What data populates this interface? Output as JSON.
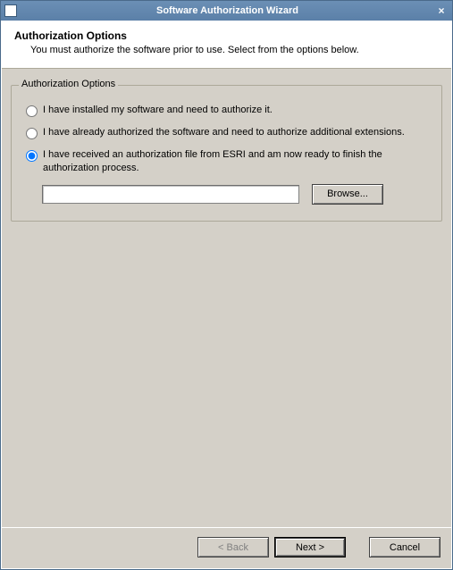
{
  "window": {
    "title": "Software Authorization Wizard"
  },
  "header": {
    "title": "Authorization Options",
    "subtitle": "You must authorize the software prior to use. Select from the options below."
  },
  "group": {
    "legend": "Authorization Options",
    "options": [
      {
        "label": "I have installed my software and need to authorize it.",
        "selected": false
      },
      {
        "label": "I have already authorized the software and need to authorize additional extensions.",
        "selected": false
      },
      {
        "label": "I have received an authorization file from ESRI and am now ready to finish the authorization process.",
        "selected": true
      }
    ],
    "file_path": "",
    "browse_label": "Browse..."
  },
  "footer": {
    "back_label": "< Back",
    "next_label": "Next >",
    "cancel_label": "Cancel",
    "back_enabled": false
  }
}
